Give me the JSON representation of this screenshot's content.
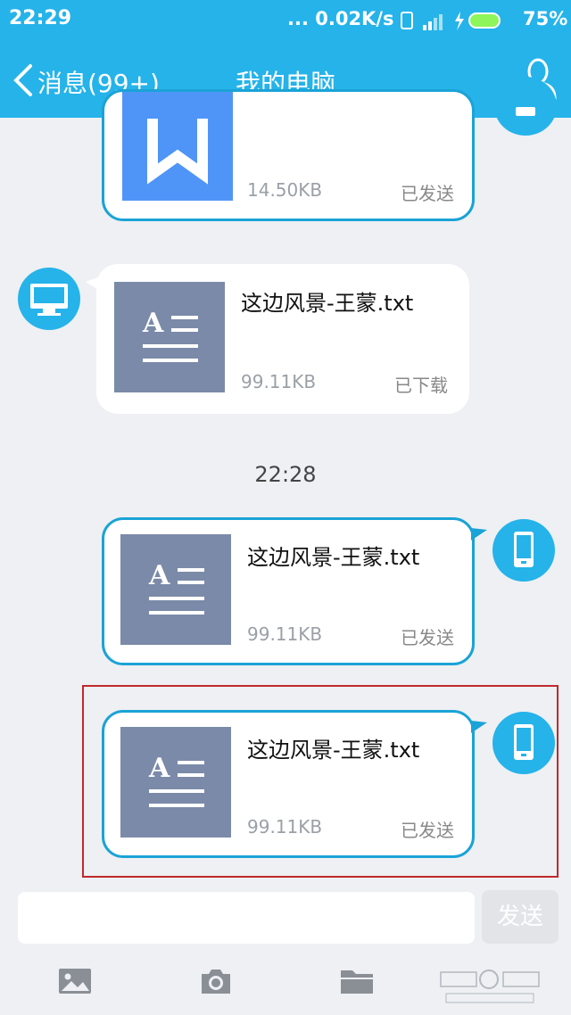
{
  "status_bar": {
    "time": "22:29",
    "network_speed": "... 0.02K/s",
    "battery": "75%"
  },
  "header": {
    "back_label": "消息(99+)",
    "title": "我的电脑"
  },
  "messages": [
    {
      "type": "sent",
      "file_icon": "word-icon",
      "file_size": "14.50KB",
      "status": "已发送"
    },
    {
      "type": "received",
      "file_icon": "txt-icon",
      "file_name": "这边风景-王蒙.txt",
      "file_size": "99.11KB",
      "status": "已下载"
    },
    {
      "type": "sent",
      "file_icon": "txt-icon",
      "file_name": "这边风景-王蒙.txt",
      "file_size": "99.11KB",
      "status": "已发送"
    },
    {
      "type": "sent",
      "file_icon": "txt-icon",
      "file_name": "这边风景-王蒙.txt",
      "file_size": "99.11KB",
      "status": "已发送"
    }
  ],
  "timestamp": "22:28",
  "composer": {
    "placeholder": "",
    "send_label": "发送"
  },
  "toolbar": {
    "items": [
      "image-icon",
      "camera-icon",
      "folder-icon"
    ]
  },
  "colors": {
    "accent": "#25b3ea",
    "sent_border": "#1aa3d6",
    "highlight": "#c0292b"
  }
}
